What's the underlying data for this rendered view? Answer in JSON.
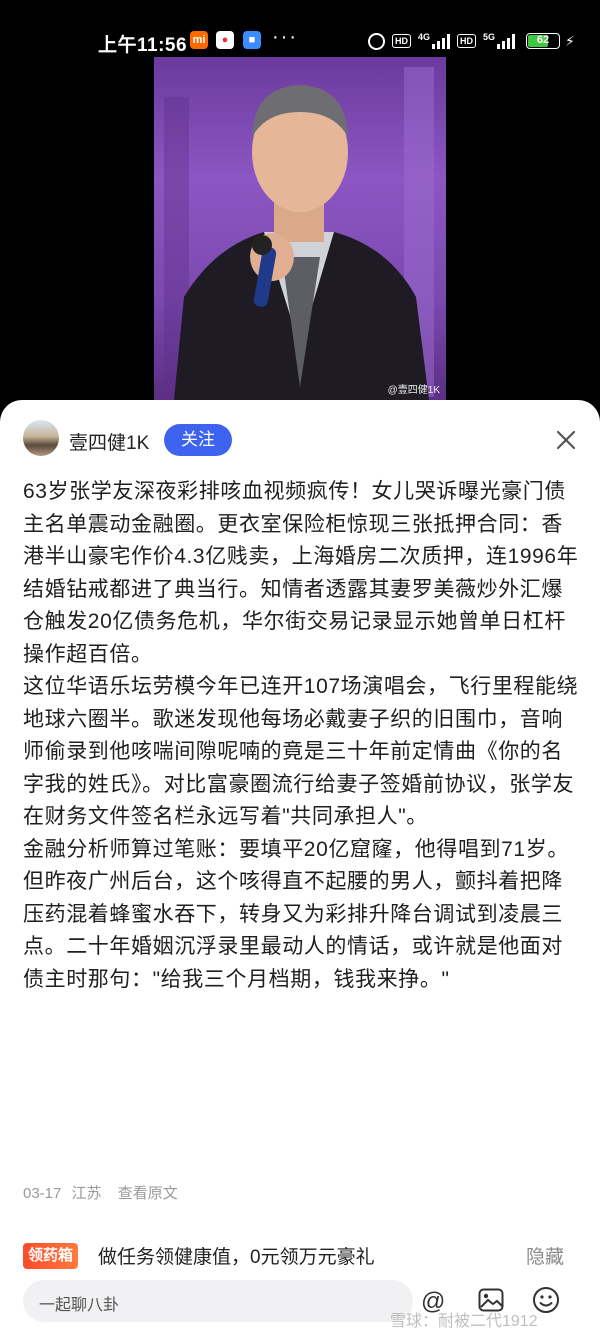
{
  "status_bar": {
    "time": "上午11:56",
    "app_icons": [
      "mi-icon",
      "map-pin-icon",
      "blue-app-icon"
    ],
    "more": "···",
    "hd1": "HD",
    "net1": "4G",
    "hd2": "HD",
    "net2": "5G",
    "battery": "62",
    "battery_level": 0.62,
    "battery_color": "#3ec93e"
  },
  "media": {
    "watermark": "@壹四健1K"
  },
  "post": {
    "author": "壹四健1K",
    "follow_label": "关注",
    "paragraphs": [
      "63岁张学友深夜彩排咳血视频疯传！女儿哭诉曝光豪门债主名单震动金融圈。更衣室保险柜惊现三张抵押合同：香港半山豪宅作价4.3亿贱卖，上海婚房二次质押，连1996年结婚钻戒都进了典当行。知情者透露其妻罗美薇炒外汇爆仓触发20亿债务危机，华尔街交易记录显示她曾单日杠杆操作超百倍。",
      "这位华语乐坛劳模今年已连开107场演唱会，飞行里程能绕地球六圈半。歌迷发现他每场必戴妻子织的旧围巾，音响师偷录到他咳喘间隙呢喃的竟是三十年前定情曲《你的名字我的姓氏》。对比富豪圈流行给妻子签婚前协议，张学友在财务文件签名栏永远写着\"共同承担人\"。",
      "金融分析师算过笔账：要填平20亿窟窿，他得唱到71岁。但昨夜广州后台，这个咳得直不起腰的男人，颤抖着把降压药混着蜂蜜水吞下，转身又为彩排升降台调试到凌晨三点。二十年婚姻沉浮录里最动人的情话，或许就是他面对债主时那句：\"给我三个月档期，钱我来挣。\""
    ],
    "date": "03-17",
    "location": "江苏",
    "view_original": "查看原文"
  },
  "promo": {
    "tag": "领药箱",
    "text": "做任务领健康值，0元领万元豪礼",
    "hide": "隐藏"
  },
  "comment_bar": {
    "placeholder": "一起聊八卦",
    "at_symbol": "@"
  },
  "watermark": "雪球：耐被二代1912",
  "colors": {
    "accent": "#3e63f0",
    "promo": "#ff4b2b"
  }
}
